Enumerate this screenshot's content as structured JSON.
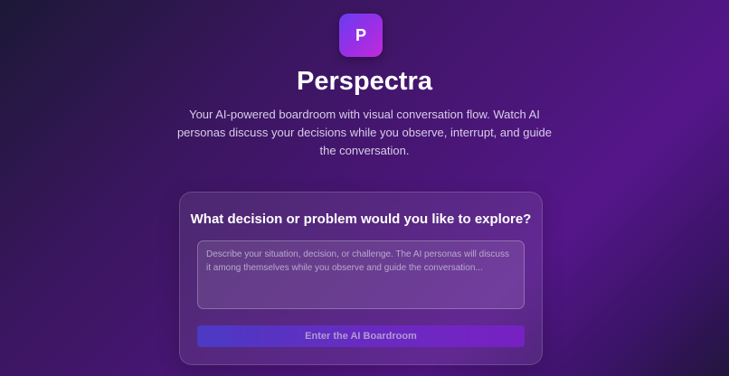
{
  "app": {
    "logo_letter": "P",
    "title": "Perspectra",
    "subtitle": "Your AI-powered boardroom with visual conversation flow. Watch AI personas discuss your decisions while you observe, interrupt, and guide the conversation."
  },
  "form": {
    "heading": "What decision or problem would you like to explore?",
    "input_value": "",
    "input_placeholder": "Describe your situation, decision, or challenge. The AI personas will discuss it among themselves while you observe and guide the conversation...",
    "submit_label": "Enter the AI Boardroom"
  },
  "colors": {
    "accent_start": "#6a3cf0",
    "accent_end": "#c12bd8",
    "background": "#4a1678"
  }
}
